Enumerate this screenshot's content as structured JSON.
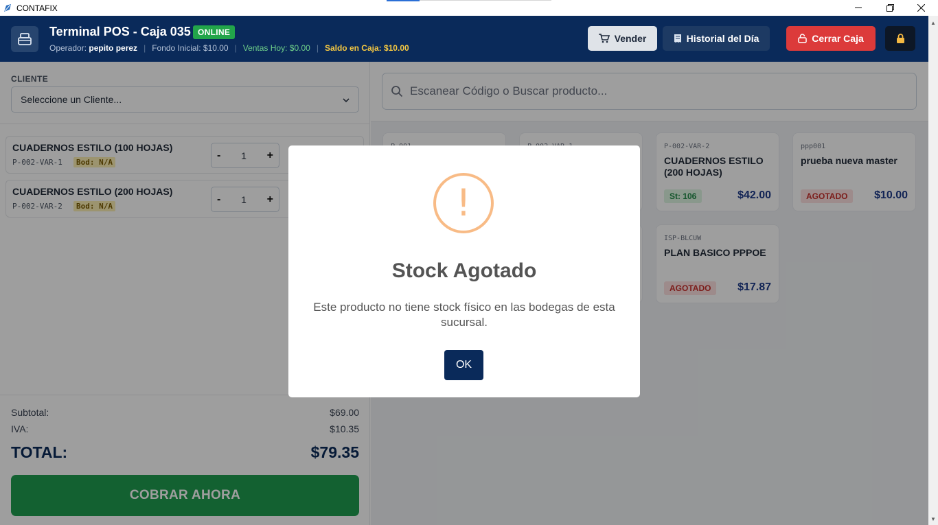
{
  "window": {
    "title": "CONTAFIX"
  },
  "header": {
    "title": "Terminal POS - Caja 035",
    "status_badge": "ONLINE",
    "operator_label": "Operador:",
    "operator_name": "pepito perez",
    "fondo_inicial": "Fondo Inicial: $10.00",
    "ventas_hoy": "Ventas Hoy: $0.00",
    "saldo_caja": "Saldo en Caja: $10.00",
    "buttons": {
      "vender": "Vender",
      "historial": "Historial del Día",
      "cerrar": "Cerrar Caja"
    }
  },
  "cliente": {
    "label": "CLIENTE",
    "placeholder": "Seleccione un Cliente..."
  },
  "cart": [
    {
      "name": "CUADERNOS ESTILO (100 HOJAS)",
      "sku": "P-002-VAR-1",
      "bodega": "Bod: N/A",
      "qty": "1"
    },
    {
      "name": "CUADERNOS ESTILO (200 HOJAS)",
      "sku": "P-002-VAR-2",
      "bodega": "Bod: N/A",
      "qty": "1"
    }
  ],
  "qty_controls": {
    "minus": "-",
    "plus": "+"
  },
  "totals": {
    "subtotal_label": "Subtotal:",
    "subtotal_value": "$69.00",
    "iva_label": "IVA:",
    "iva_value": "$10.35",
    "total_label": "TOTAL:",
    "total_value": "$79.35",
    "cobrar_label": "COBRAR AHORA"
  },
  "search": {
    "placeholder": "Escanear Código o Buscar producto..."
  },
  "products": [
    {
      "sku": "P-001",
      "name": "",
      "badge": "",
      "price": ""
    },
    {
      "sku": "P-002-VAR-1",
      "name": "",
      "badge": "",
      "price": ""
    },
    {
      "sku": "P-002-VAR-2",
      "name": "CUADERNOS ESTILO (200 HOJAS)",
      "badge": "St: 106",
      "price": "$42.00"
    },
    {
      "sku": "ppp001",
      "name": "prueba nueva master",
      "badge": "AGOTADO",
      "price": "$10.00"
    },
    {
      "sku": "ISP-BLCUW",
      "name": "PLAN BASICO PPPOE",
      "badge": "AGOTADO",
      "price": "$17.87"
    }
  ],
  "modal": {
    "title": "Stock Agotado",
    "message": "Este producto no tiene stock físico en las bodegas de esta sucursal.",
    "ok_label": "OK"
  },
  "colors": {
    "header_bg": "#0a2a5a",
    "online_green": "#22a54a",
    "cobrar_green": "#1f9d4f",
    "cerrar_red": "#dc3a3a",
    "warning_orange": "#f8bb86"
  }
}
